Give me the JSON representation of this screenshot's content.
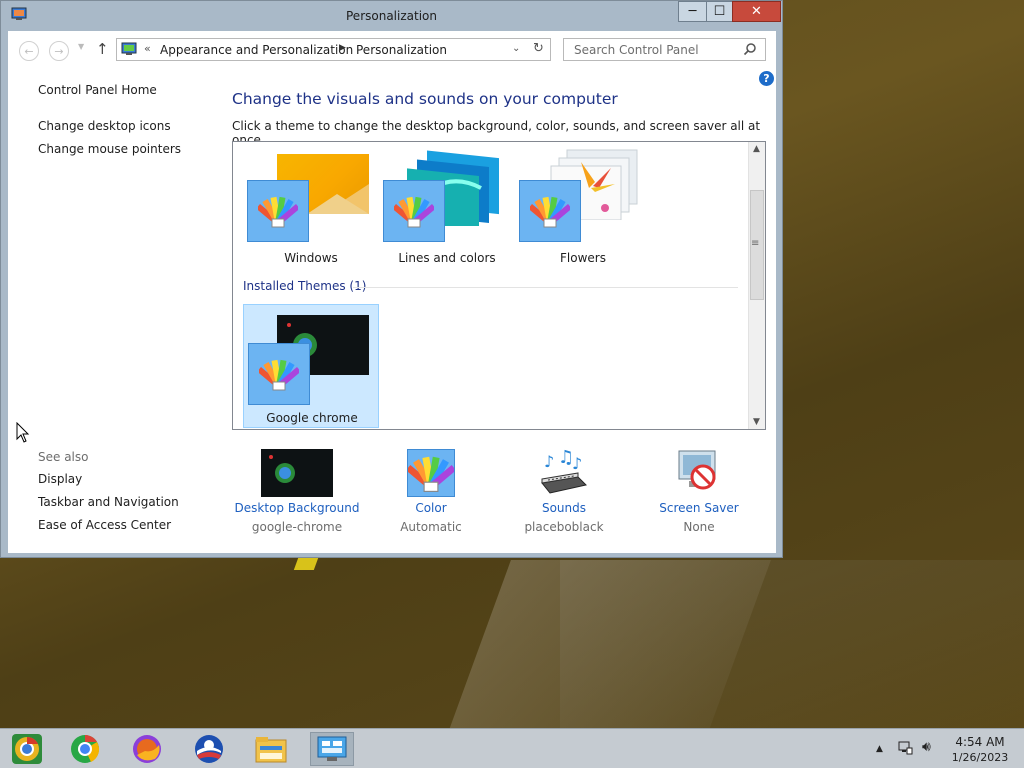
{
  "window": {
    "title": "Personalization",
    "buttons": {
      "minimize": "─",
      "maximize": "☐",
      "close": "✕"
    }
  },
  "address_bar": {
    "overflow": "«",
    "crumbs": [
      "Appearance and Personalization",
      "Personalization"
    ],
    "separator": "▶",
    "search_placeholder": "Search Control Panel"
  },
  "left_pane": {
    "links": [
      "Control Panel Home",
      "Change desktop icons",
      "Change mouse pointers"
    ],
    "see_also_label": "See also",
    "see_also": [
      "Display",
      "Taskbar and Navigation",
      "Ease of Access Center"
    ]
  },
  "main": {
    "heading": "Change the visuals and sounds on your computer",
    "subtext": "Click a theme to change the desktop background, color, sounds, and screen saver all at once.",
    "themes": [
      "Windows",
      "Lines and colors",
      "Flowers"
    ],
    "installed_label": "Installed Themes (1)",
    "installed_themes": [
      "Google chrome"
    ],
    "selected_theme": "Google chrome"
  },
  "bottom": {
    "desktop_background": {
      "label": "Desktop Background",
      "value": "google-chrome"
    },
    "color": {
      "label": "Color",
      "value": "Automatic"
    },
    "sounds": {
      "label": "Sounds",
      "value": "placeboblack"
    },
    "screen_saver": {
      "label": "Screen Saver",
      "value": "None"
    }
  },
  "taskbar": {
    "apps": [
      "chrome-canary-icon",
      "chrome-icon",
      "firefox-icon",
      "opera-icon",
      "file-explorer-icon",
      "control-panel-icon"
    ],
    "active_app": "control-panel-icon",
    "time": "4:54 AM",
    "date": "1/26/2023"
  },
  "colors": {
    "link": "#1e5fbf",
    "heading": "#1e3287",
    "selection": "#cce8ff",
    "close_button": "#c74a3c"
  }
}
